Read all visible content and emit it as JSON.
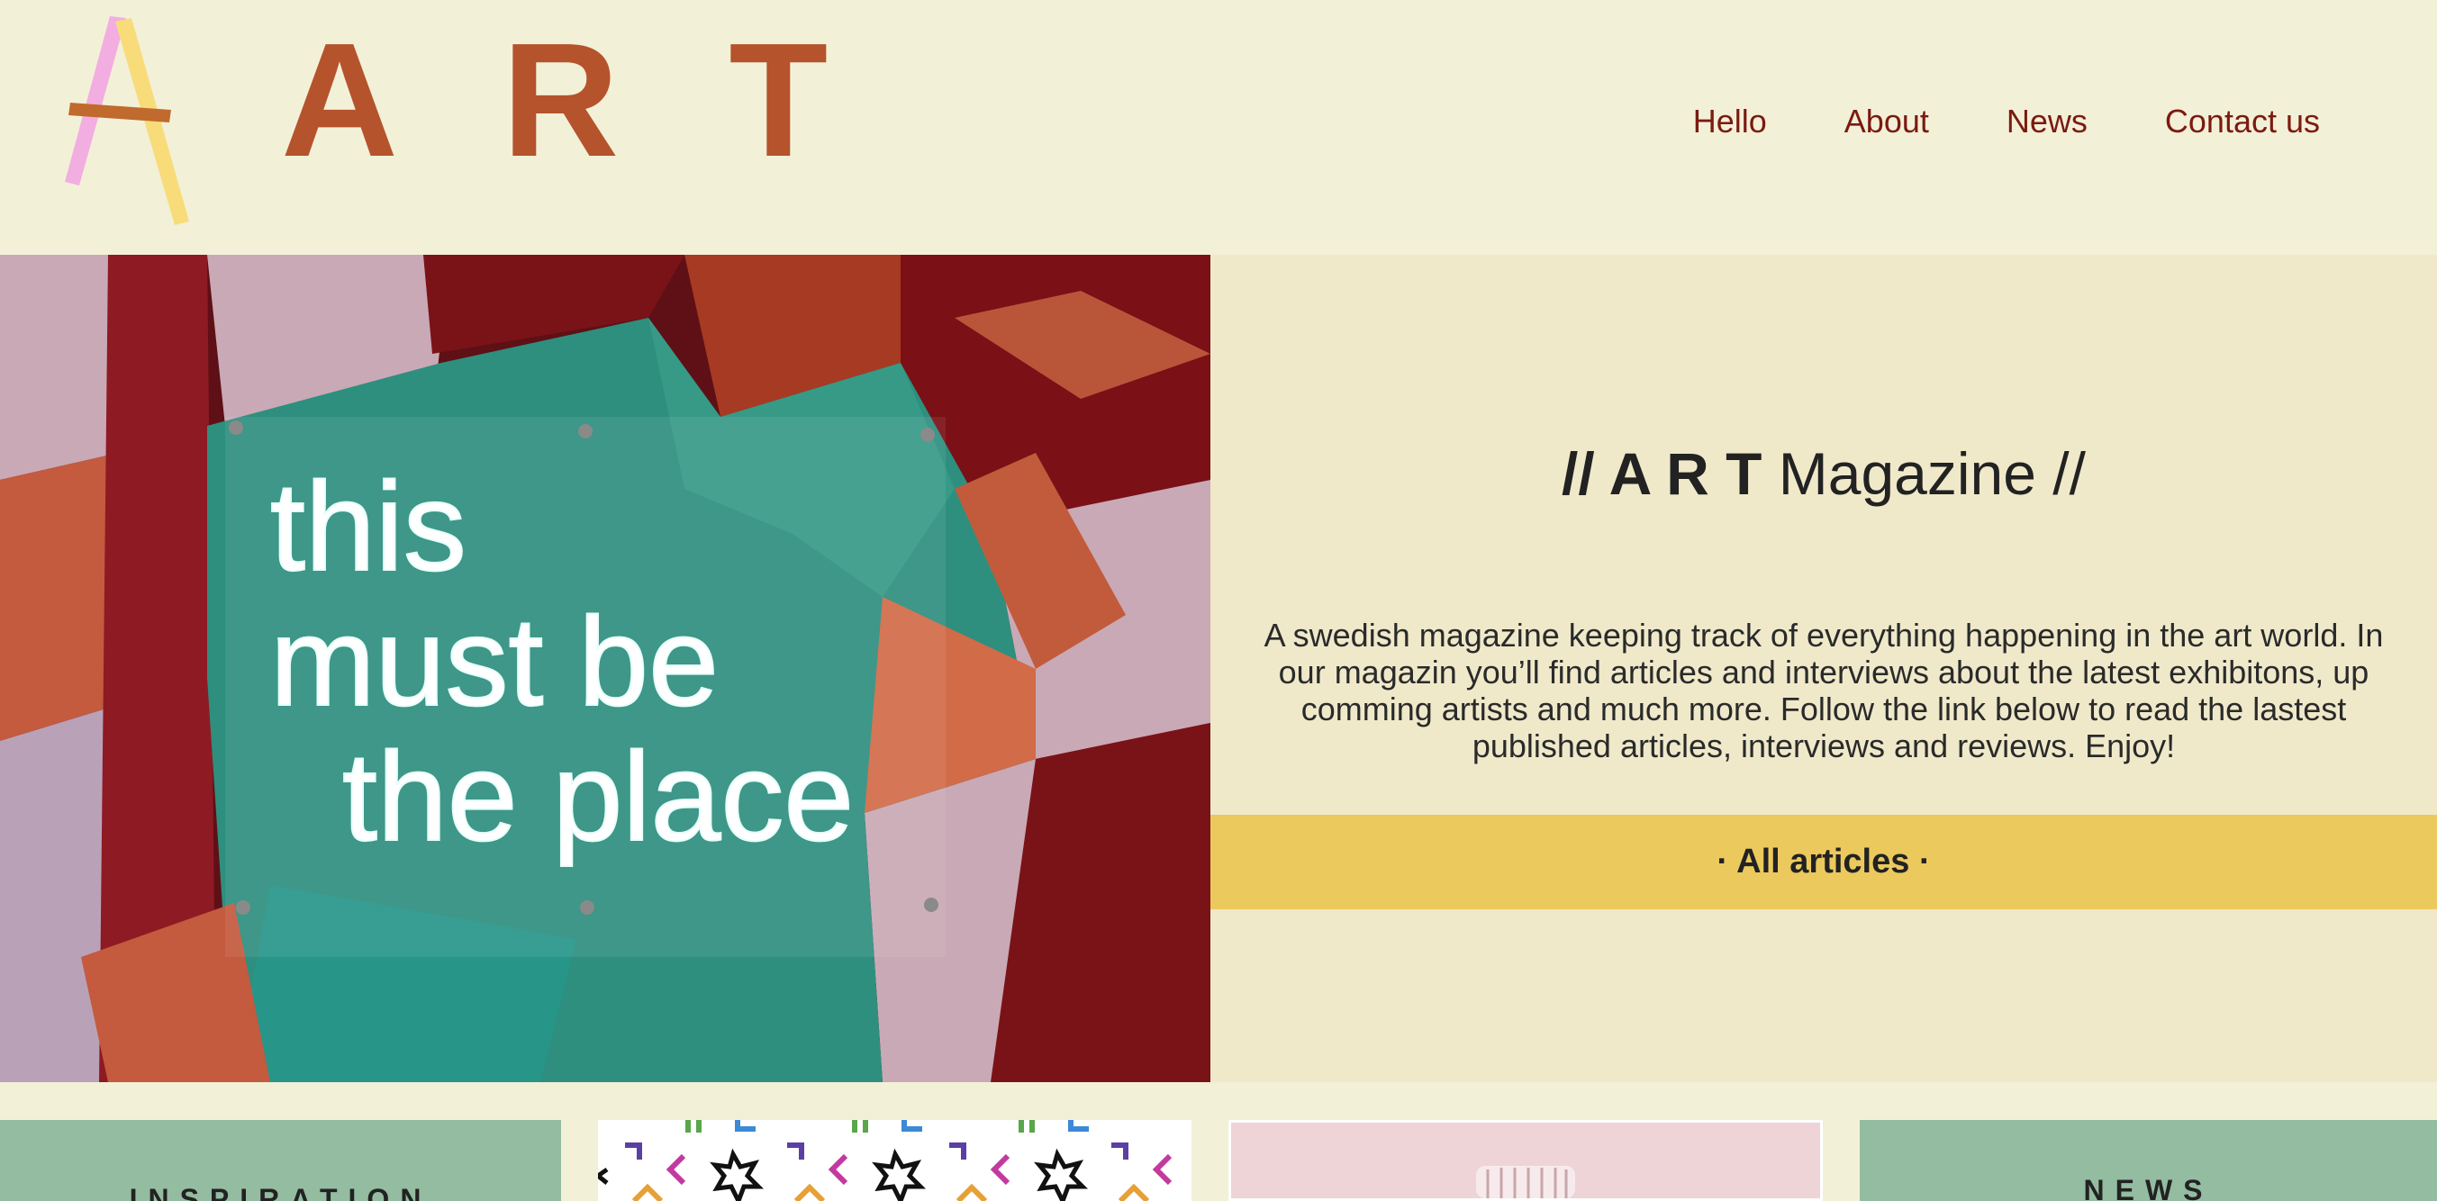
{
  "header": {
    "brand": "A R T",
    "nav": [
      "Hello",
      "About",
      "News",
      "Contact us"
    ]
  },
  "hero": {
    "title_bold": "// A R T",
    "title_rest": " Magazine //",
    "description": "A swedish magazine keeping track of everything happening in the art world. In our magazin you’ll find articles and interviews about the latest exhibitons, up comming artists and much more. Follow the link below to read the lastest published articles, interviews and reviews. Enjoy!",
    "cta": "· All articles ·",
    "image_text_lines": [
      "this",
      "must be",
      "the place"
    ]
  },
  "cards": [
    {
      "title": "INSPIRATION"
    },
    {
      "title": ""
    },
    {
      "title": ""
    },
    {
      "title": "NEWS"
    }
  ],
  "colors": {
    "background": "#f3f0d8",
    "brand": "#b5532c",
    "nav": "#7b1a10",
    "hero_panel": "#efe9ca",
    "cta": "#ecc95d",
    "card_green": "#93bca1"
  }
}
